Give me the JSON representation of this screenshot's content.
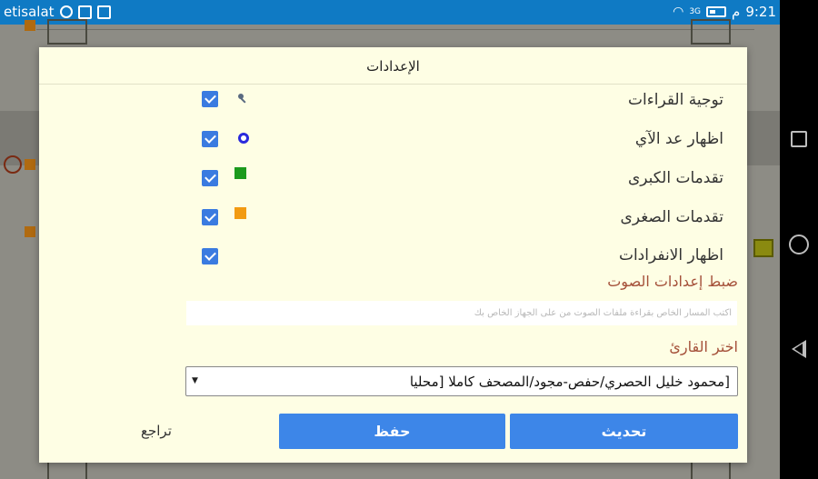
{
  "statusbar": {
    "carrier": "etisalat",
    "time": "9:21",
    "ampm": "م",
    "network": "3G"
  },
  "dialog": {
    "title": "الإعدادات",
    "options": [
      {
        "label": "توجية القراءات",
        "checked": true,
        "icon": "key-icon"
      },
      {
        "label": "اظهار عد الآي",
        "checked": true,
        "icon": "gear-icon"
      },
      {
        "label": "تقدمات الكبرى",
        "checked": true,
        "icon": "green-square-icon",
        "color": "#1c9a1c"
      },
      {
        "label": "تقدمات الصغرى",
        "checked": true,
        "icon": "orange-square-icon",
        "color": "#f29b12"
      },
      {
        "label": "اظهار الانفرادات",
        "checked": true
      }
    ],
    "audio_section_title": "ضبط إعدادات الصوت",
    "path_placeholder": "اكتب المسار الخاص بقراءة ملفات الصوت من على الجهاز الخاص بك",
    "reciter_section_title": "اختر القارئ",
    "reciter_selected": "[محمود خليل الحصري/حفص-مجود/المصحف كاملا [محليا",
    "buttons": {
      "update": "تحديث",
      "save": "حفظ",
      "back": "تراجع"
    }
  },
  "colors": {
    "accent": "#3d86e8",
    "statusbar": "#0f7ac4",
    "dialog_bg": "#fefee4",
    "section_title": "#a5513a"
  }
}
